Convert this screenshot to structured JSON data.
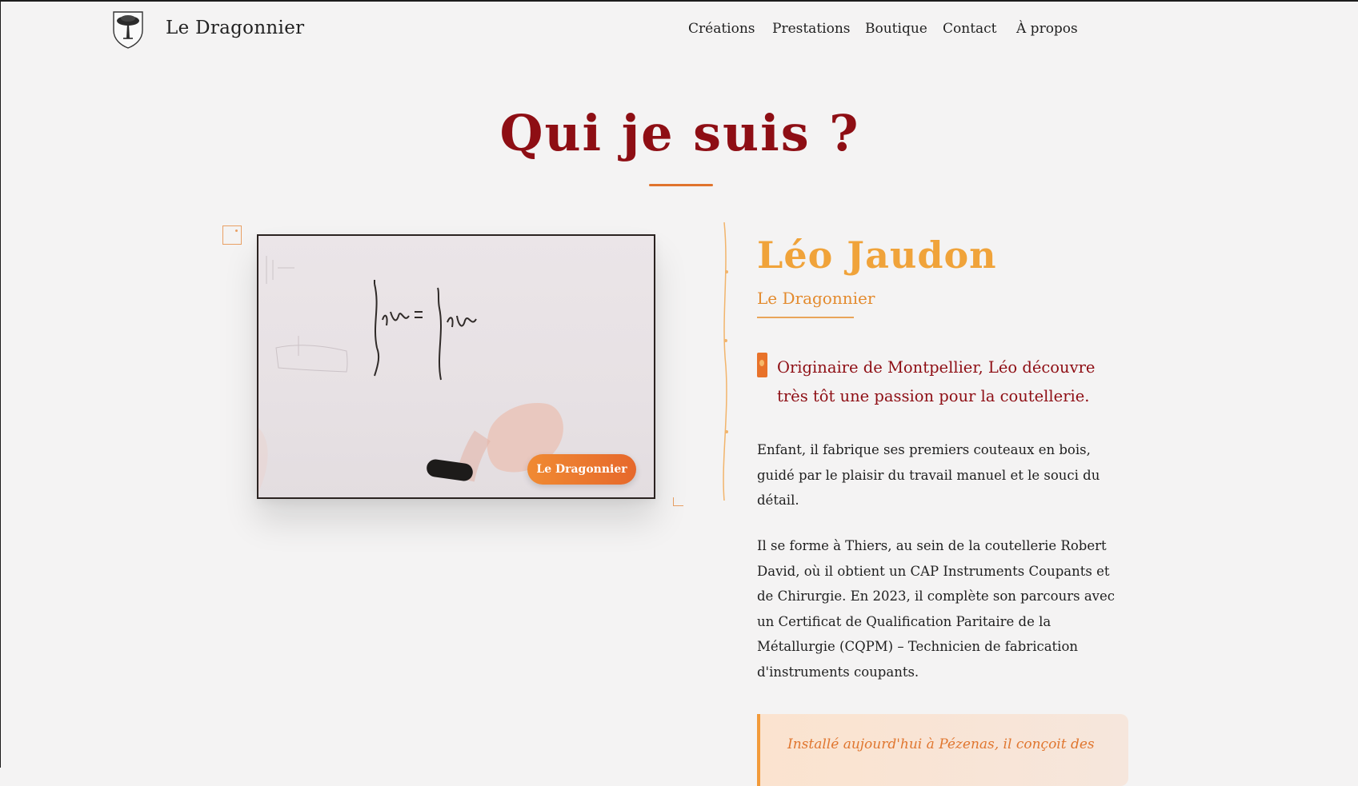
{
  "header": {
    "brand": "Le Dragonnier",
    "nav": [
      {
        "label": "Créations"
      },
      {
        "label": "Prestations"
      },
      {
        "label": "Boutique"
      },
      {
        "label": "Contact"
      },
      {
        "label": "À propos"
      }
    ]
  },
  "main": {
    "title": "Qui je suis ?",
    "photo": {
      "badge": "Le Dragonnier",
      "board_formula": "∫ r² dm = ∫ r² dm"
    },
    "person": {
      "name": "Léo Jaudon",
      "role": "Le Dragonnier",
      "intro": "Originaire de Montpellier, Léo découvre très tôt une passion pour la coutellerie.",
      "paragraphs": [
        "Enfant, il fabrique ses premiers couteaux en bois, guidé par le plaisir du travail manuel et le souci du détail.",
        "Il se forme à Thiers, au sein de la coutellerie Robert David, où il obtient un CAP Instruments Coupants et de Chirurgie. En 2023, il complète son parcours avec un Certificat de Qualification Paritaire de la Métallurgie (CQPM) – Technicien de fabrication d'instruments coupants."
      ],
      "callout": "Installé aujourd'hui à Pézenas, il conçoit des"
    }
  },
  "colors": {
    "title": "#8e0e14",
    "name": "#f0a33a",
    "accent": "#e8722a",
    "background": "#f4f3f3"
  },
  "icons": {
    "logo": "tree-shield-icon"
  }
}
